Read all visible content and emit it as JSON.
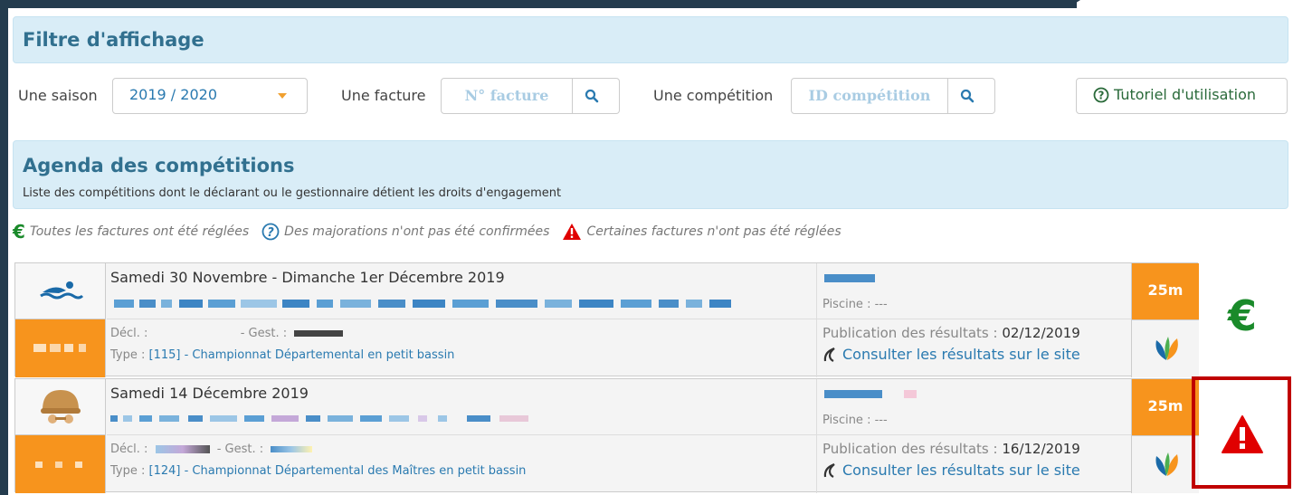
{
  "filter": {
    "title": "Filtre d'affichage",
    "season_label": "Une saison",
    "season_value": "2019 / 2020",
    "invoice_label": "Une facture",
    "invoice_placeholder": "N° facture",
    "competition_label": "Une compétition",
    "competition_placeholder": "ID compétition",
    "tutorial_label": "Tutoriel d'utilisation"
  },
  "agenda": {
    "title": "Agenda des compétitions",
    "subtitle": "Liste des compétitions dont le déclarant ou le gestionnaire détient les droits d'engagement"
  },
  "legend": {
    "paid": "Toutes les factures ont été réglées",
    "pending": "Des majorations n'ont pas été confirmées",
    "unpaid": "Certaines factures n'ont pas été réglées"
  },
  "competitions": [
    {
      "date": "Samedi 30 Novembre  - Dimanche 1er Décembre 2019",
      "decl": "Décl. :",
      "gest": "- Gest. :",
      "type_label": "Type :",
      "type_value": "[115] - Championnat Départemental en petit bassin",
      "piscine": "Piscine : ---",
      "pub_label": "Publication des résultats :",
      "pub_date": "02/12/2019",
      "consult": "Consulter les résultats sur le site",
      "pool": "25m",
      "status": "€"
    },
    {
      "date": "Samedi 14 Décembre 2019",
      "decl": "Décl. :",
      "gest": "- Gest. :",
      "type_label": "Type :",
      "type_value": "[124] - Championnat Départemental des Maîtres en petit bassin",
      "piscine": "Piscine : ---",
      "pub_label": "Publication des résultats :",
      "pub_date": "16/12/2019",
      "consult": "Consulter les résultats sur le site",
      "pool": "25m",
      "status": "alert"
    }
  ],
  "colors": {
    "panel": "#d9edf7",
    "accent_orange": "#f7941d",
    "link_blue": "#2a7ab0",
    "paid_green": "#1a8a2a",
    "alert_red": "#e00000"
  }
}
